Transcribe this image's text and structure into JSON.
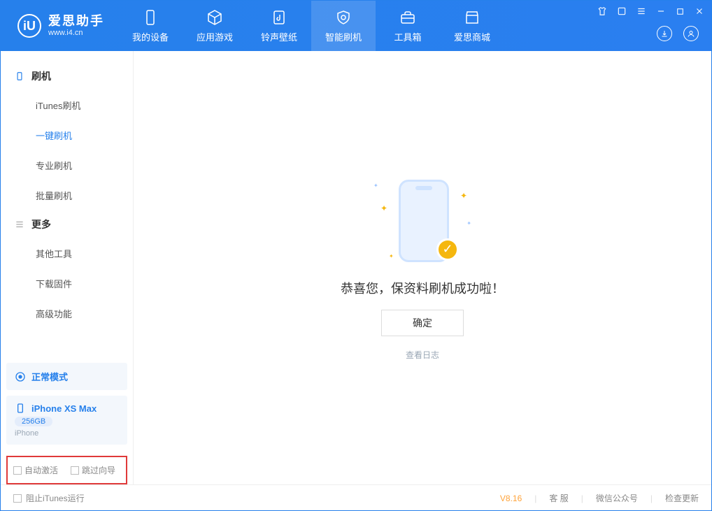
{
  "app": {
    "name": "爱思助手",
    "url": "www.i4.cn"
  },
  "nav": {
    "items": [
      {
        "label": "我的设备"
      },
      {
        "label": "应用游戏"
      },
      {
        "label": "铃声壁纸"
      },
      {
        "label": "智能刷机"
      },
      {
        "label": "工具箱"
      },
      {
        "label": "爱思商城"
      }
    ],
    "active_index": 3
  },
  "sidebar": {
    "group_flash": "刷机",
    "items_flash": [
      {
        "label": "iTunes刷机"
      },
      {
        "label": "一键刷机"
      },
      {
        "label": "专业刷机"
      },
      {
        "label": "批量刷机"
      }
    ],
    "active_flash_index": 1,
    "group_more": "更多",
    "items_more": [
      {
        "label": "其他工具"
      },
      {
        "label": "下载固件"
      },
      {
        "label": "高级功能"
      }
    ]
  },
  "mode": {
    "label": "正常模式"
  },
  "device": {
    "name": "iPhone XS Max",
    "capacity": "256GB",
    "type": "iPhone"
  },
  "options": {
    "auto_activate": "自动激活",
    "skip_guide": "跳过向导"
  },
  "result": {
    "message": "恭喜您，保资料刷机成功啦！",
    "confirm": "确定",
    "view_log": "查看日志"
  },
  "footer": {
    "block_itunes": "阻止iTunes运行",
    "version": "V8.16",
    "support": "客 服",
    "wechat": "微信公众号",
    "update": "检查更新"
  }
}
